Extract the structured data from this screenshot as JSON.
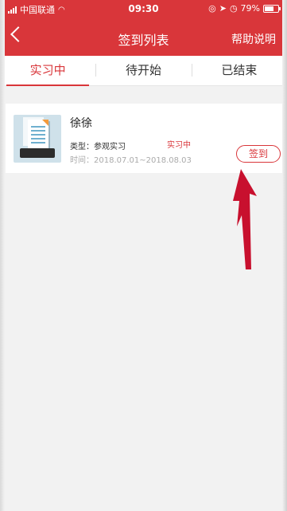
{
  "status_bar": {
    "carrier": "中国联通",
    "time": "09:30",
    "battery": "79%",
    "battery_level": 0.79
  },
  "nav": {
    "title": "签到列表",
    "help": "帮助说明"
  },
  "tabs": [
    {
      "label": "实习中",
      "active": true
    },
    {
      "label": "待开始",
      "active": false
    },
    {
      "label": "已结束",
      "active": false
    }
  ],
  "card": {
    "name": "徐徐",
    "type": "类型：参观实习",
    "status": "实习中",
    "time": "时间：2018.07.01~2018.08.03",
    "button": "签到"
  },
  "colors": {
    "brand_red": "#d9363a",
    "arrow_red": "#c8102e"
  }
}
